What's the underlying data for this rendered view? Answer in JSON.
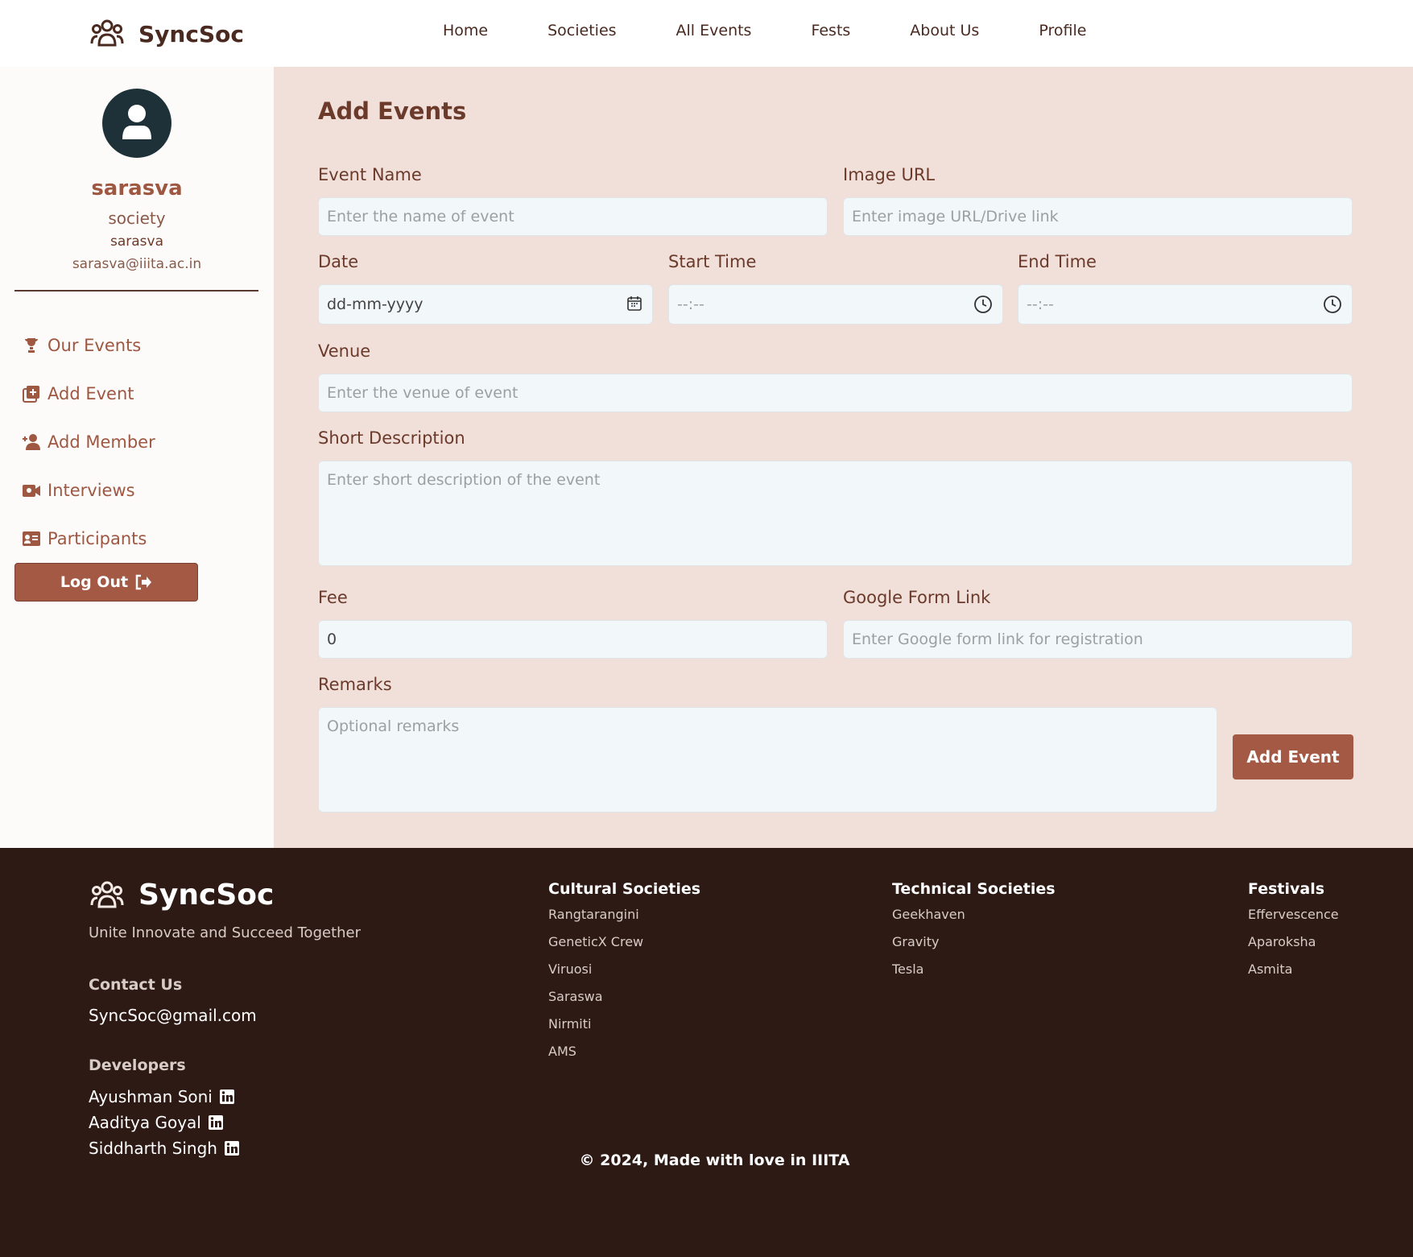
{
  "header": {
    "brand": "SyncSoc",
    "nav": [
      "Home",
      "Societies",
      "All Events",
      "Fests",
      "About Us",
      "Profile"
    ]
  },
  "sidebar": {
    "username": "sarasva",
    "role": "society",
    "handle": "sarasva",
    "email": "sarasva@iiita.ac.in",
    "menu": [
      {
        "label": "Our Events",
        "icon": "trophy-icon"
      },
      {
        "label": "Add Event",
        "icon": "add-square-icon"
      },
      {
        "label": "Add Member",
        "icon": "user-plus-icon"
      },
      {
        "label": "Interviews",
        "icon": "video-camera-icon"
      },
      {
        "label": "Participants",
        "icon": "id-card-icon"
      }
    ],
    "logout": "Log Out"
  },
  "form": {
    "title": "Add Events",
    "event_name": {
      "label": "Event Name",
      "placeholder": "Enter the name of event"
    },
    "image_url": {
      "label": "Image URL",
      "placeholder": "Enter image URL/Drive link"
    },
    "date": {
      "label": "Date",
      "placeholder": "dd-mm-yyyy"
    },
    "start_time": {
      "label": "Start Time",
      "placeholder": "--:--"
    },
    "end_time": {
      "label": "End Time",
      "placeholder": "--:--"
    },
    "venue": {
      "label": "Venue",
      "placeholder": "Enter the venue of event"
    },
    "short_description": {
      "label": "Short Description",
      "placeholder": "Enter short description of the event"
    },
    "fee": {
      "label": "Fee",
      "value": "0"
    },
    "google_form": {
      "label": "Google Form Link",
      "placeholder": "Enter Google form link for registration"
    },
    "remarks": {
      "label": "Remarks",
      "placeholder": "Optional remarks"
    },
    "submit": "Add Event"
  },
  "footer": {
    "brand": "SyncSoc",
    "tagline": "Unite Innovate and Succeed Together",
    "contact_heading": "Contact Us",
    "contact_email": "SyncSoc@gmail.com",
    "developers_heading": "Developers",
    "developers": [
      "Ayushman Soni",
      "Aaditya Goyal",
      "Siddharth Singh"
    ],
    "cultural": {
      "title": "Cultural Societies",
      "items": [
        "Rangtarangini",
        "GeneticX Crew",
        "Viruosi",
        "Saraswa",
        "Nirmiti",
        "AMS"
      ]
    },
    "technical": {
      "title": "Technical Societies",
      "items": [
        "Geekhaven",
        "Gravity",
        "Tesla"
      ]
    },
    "festivals": {
      "title": "Festivals",
      "items": [
        "Effervescence",
        "Aparoksha",
        "Asmita"
      ]
    },
    "copyright": "© 2024, Made with love in IIITA"
  },
  "colors": {
    "accent": "#a45944",
    "main_bg": "#f1dfda",
    "footer_bg": "#2e1a15",
    "avatar_bg": "#1f3138"
  }
}
